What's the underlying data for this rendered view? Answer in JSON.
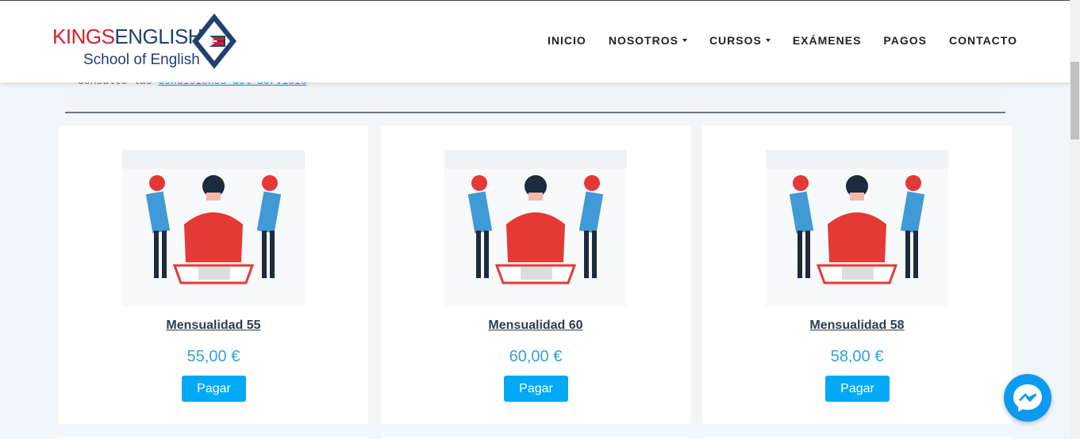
{
  "logo": {
    "brand_part1": "KINGS",
    "brand_part2": "ENGLISH",
    "subtitle": "School of English"
  },
  "nav": [
    {
      "label": "INICIO",
      "dropdown": false
    },
    {
      "label": "NOSOTROS",
      "dropdown": true
    },
    {
      "label": "CURSOS",
      "dropdown": true
    },
    {
      "label": "EXÁMENES",
      "dropdown": false
    },
    {
      "label": "PAGOS",
      "dropdown": false
    },
    {
      "label": "CONTACTO",
      "dropdown": false
    }
  ],
  "notice": {
    "prefix": "Consulte las ",
    "link": "Condiciones del Servicio"
  },
  "products": [
    {
      "title": "Mensualidad 55",
      "price": "55,00 €",
      "button": "Pagar"
    },
    {
      "title": "Mensualidad 60",
      "price": "60,00 €",
      "button": "Pagar"
    },
    {
      "title": "Mensualidad 58",
      "price": "58,00 €",
      "button": "Pagar"
    }
  ],
  "colors": {
    "brand_red": "#d4202c",
    "brand_navy": "#22406e",
    "accent_blue": "#03a9f4",
    "price_blue": "#31a3d8",
    "page_bg": "#f1f6fa"
  },
  "icons": {
    "messenger": "messenger-icon",
    "dropdown": "caret-down-icon"
  }
}
